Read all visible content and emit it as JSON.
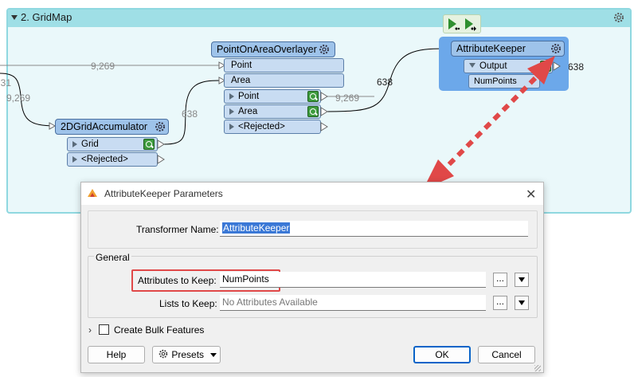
{
  "bookmark": {
    "title": "2. GridMap"
  },
  "transformers": {
    "overlayer": {
      "name": "PointOnAreaOverlayer",
      "inputs": [
        "Point",
        "Area"
      ],
      "outputs": [
        "Point",
        "Area",
        "<Rejected>"
      ]
    },
    "accumulator": {
      "name": "2DGridAccumulator",
      "outputs": [
        "Grid",
        "<Rejected>"
      ]
    },
    "keeper": {
      "name": "AttributeKeeper",
      "output": "Output",
      "attribute": "NumPoints"
    }
  },
  "counts": {
    "left_top": "9,269",
    "left_lower": "9,269",
    "edge_cut": "31",
    "grid_to_area": "638",
    "point_out": "9,269",
    "area_to_keeper": "638",
    "keeper_out": "638"
  },
  "dialog": {
    "title": "AttributeKeeper Parameters",
    "close": "✕",
    "transformer_name_label": "Transformer Name:",
    "transformer_name_value": "AttributeKeeper",
    "group_label": "General",
    "attributes_label": "Attributes to Keep:",
    "attributes_value": "NumPoints",
    "lists_label": "Lists to Keep:",
    "lists_placeholder": "No Attributes Available",
    "ellipsis": "...",
    "bulk_label": "Create Bulk Features",
    "help": "Help",
    "presets": "Presets",
    "ok": "OK",
    "cancel": "Cancel"
  },
  "colors": {
    "bookmark": "#9fdfe6",
    "transformer": "#9ec3ea",
    "selected": "#6ca8ea",
    "annotation": "#e04848",
    "ok_border": "#0a64c8"
  }
}
